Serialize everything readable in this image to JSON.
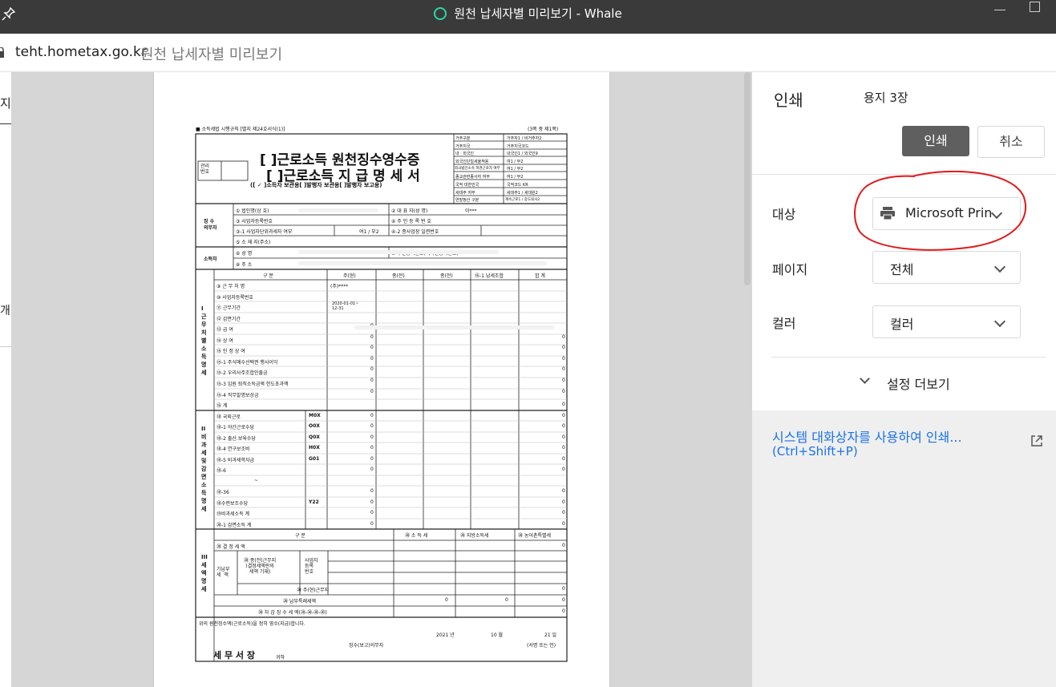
{
  "window": {
    "title": "원천 납세자별 미리보기 - Whale"
  },
  "address": {
    "host": "teht.hometax.go.kr",
    "page_title": "원천 납세자별 미리보기"
  },
  "left_strip": {
    "chars": [
      "지",
      "개"
    ]
  },
  "print_panel": {
    "heading": "인쇄",
    "sheet_count": "용지 3장",
    "print_button": "인쇄",
    "cancel_button": "취소",
    "destination_label": "대상",
    "destination_value": "Microsoft Prin",
    "pages_label": "페이지",
    "pages_value": "전체",
    "color_label": "컬러",
    "color_value": "컬러",
    "more_settings": "설정 더보기",
    "system_dialog": "시스템 대화상자를 사용하여 인쇄...",
    "system_dialog_shortcut": "(Ctrl+Shift+P)",
    "annotation_color": "#e0191b",
    "print_button_color": "#5f5f5f"
  },
  "form": {
    "law_ref": "■ 소득세법 시행규칙 [별지 제24호서식(1)]",
    "page_ref": "(3쪽 중 제1쪽)",
    "manage_no": "관리\n번호",
    "title1": "[  ]근로소득 원천징수영수증",
    "title2": "[  ]근로소득 지 급 명 세 서",
    "copies": "([ ✓ ]소득자 보관용[    ]발행자 보관용[    ]발행자 보고용)",
    "right_box": [
      [
        "거주구분",
        "거주자1 / 비거주자2"
      ],
      [
        "거주지국",
        "거주지국코드"
      ],
      [
        "내ㆍ외국인",
        "내국인1 / 외국인9"
      ],
      [
        "외국인단일세율적용",
        "여1 / 부2"
      ],
      [
        "외국법인소속 파견근로자 여부",
        "여1 / 부2"
      ],
      [
        "종교관련종사자 여부",
        "여1 / 부2"
      ],
      [
        "국적  대한민국",
        "국적코드  KR"
      ],
      [
        "세대주 여부",
        "세대주1 / 세대원2"
      ],
      [
        "연말정산 구분",
        "계속근로1 / 중도퇴사2"
      ]
    ],
    "payer_label": "징 수\n의무자",
    "payer_rows": [
      "① 법인명(상 호)",
      "③ 사업자등록번호",
      "③-1 사업자단위과세자 여부",
      "⑤ 소 재 지(주소)"
    ],
    "payer_right": [
      "② 대 표 자(성 명)",
      "④ 주 민 등 록 번 호",
      "④-2 종사업장 일련번호"
    ],
    "rep_value": "이***",
    "unit_yn": "여1 / 부2",
    "earner_label": "소득자",
    "earner_rows": [
      "⑥ 성      명",
      "⑧ 주      소"
    ],
    "earner_right": "⑦ 주민등록번호(외국인등록번호)",
    "col_heads": [
      "구    분",
      "주(현)",
      "종(전)",
      "종(전)",
      "⑯-1 납세조합",
      "합    계"
    ],
    "section1_label": "I 근무처별소득명세",
    "section1_rows": [
      "⑨ 근 무 처 명",
      "⑩ 사업자등록번호",
      "⑪ 근무기간",
      "⑫ 감면기간",
      "⑬ 급     여",
      "⑭ 상     여",
      "⑮ 인 정 상 여",
      "⑮-1 주식매수선택권 행사이익",
      "⑮-2 우리사주조합인출금",
      "⑮-3 임원 퇴직소득금액 한도초과액",
      "⑮-4 직무발명보상금",
      "⑯ 계"
    ],
    "workplace": "(주)****",
    "period": "2020-01-01~\n12-31",
    "section2_label": "II 비과세및감면소득명세",
    "section2_rows": [
      [
        "⑱ 국외근로",
        "M0X"
      ],
      [
        "⑱-1 야간근로수당",
        "O0X"
      ],
      [
        "⑱-2 출산.보육수당",
        "Q0X"
      ],
      [
        "⑱-4 연구보조비",
        "H0X"
      ],
      [
        "⑱-5 비과세학자금",
        "G01"
      ],
      [
        "⑱-6",
        ""
      ],
      [
        "~",
        ""
      ],
      [
        "⑱-36",
        ""
      ],
      [
        "⑱수련보조수당",
        "Y22"
      ],
      [
        "⑲비과세소득 계",
        ""
      ],
      [
        "⑳-1 감면소득 계",
        ""
      ]
    ],
    "section3_label": "III 세액명세",
    "tax_heads": [
      "구    분",
      "⑳ 소 득 세",
      "⑳ 지방소득세",
      "⑳ 농어촌특별세"
    ],
    "tax_rows": [
      "⑳ 결  정  세  액",
      "⑳ 주(현)근무지",
      "⑳ 납부특례세액",
      "⑳ 차 감 징 수 세 액(⑳-⑳-⑳-⑳)"
    ],
    "prepaid_label": "기납부\n세  액",
    "prev_job": "⑳ 종(전)근무지\n(결정세액란의\n세액 기재)",
    "biz_reg": "사업자\n등록\n번호",
    "zero": "0",
    "receipt_text": "위의 원천징수액(근로소득)을 정히 영수(지급)합니다.",
    "year": "2021  년",
    "month": "10  월",
    "day": "21  일",
    "payer_sig": "징수(보고)의무자",
    "sig_mark": "(서명 또는 인)",
    "office": "세 무 서 장",
    "office_suffix": "귀하"
  }
}
